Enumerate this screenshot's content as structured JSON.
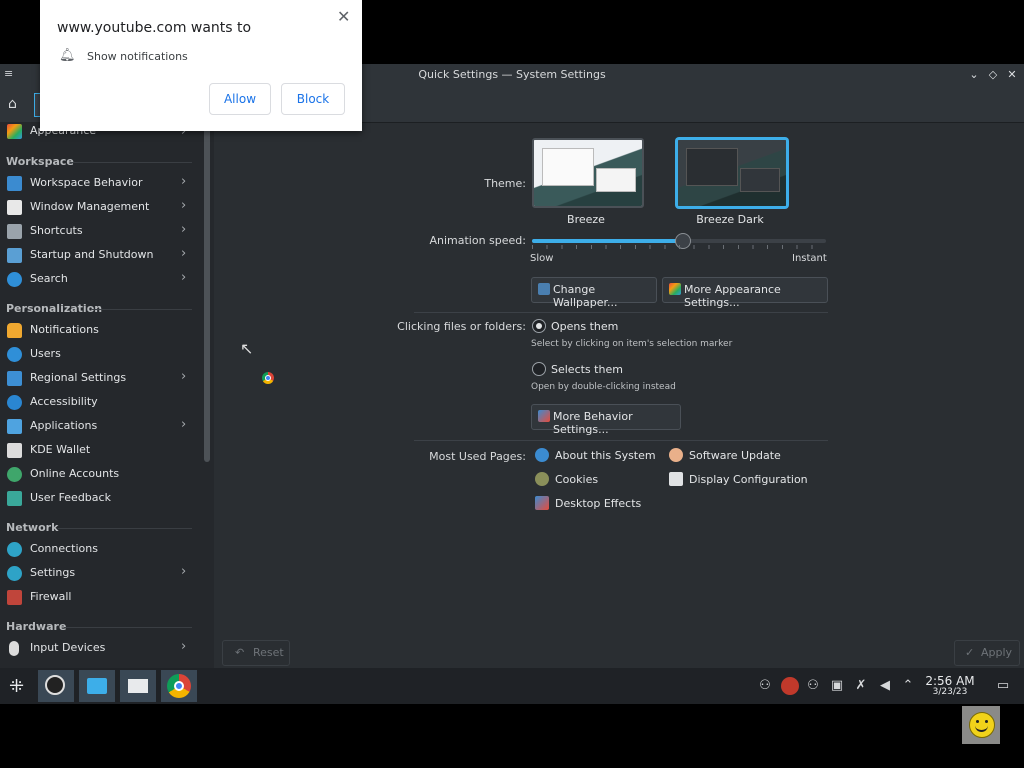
{
  "window": {
    "title": "Quick Settings — System Settings",
    "controls": [
      "minimize",
      "maximize",
      "close"
    ]
  },
  "sidebar": {
    "partial_top_item": "Appearance",
    "sections": [
      {
        "title": "Workspace",
        "items": [
          {
            "label": "Workspace Behavior",
            "has_children": true
          },
          {
            "label": "Window Management",
            "has_children": true
          },
          {
            "label": "Shortcuts",
            "has_children": true
          },
          {
            "label": "Startup and Shutdown",
            "has_children": true
          },
          {
            "label": "Search",
            "has_children": true
          }
        ]
      },
      {
        "title": "Personalization",
        "items": [
          {
            "label": "Notifications",
            "has_children": false
          },
          {
            "label": "Users",
            "has_children": false
          },
          {
            "label": "Regional Settings",
            "has_children": true
          },
          {
            "label": "Accessibility",
            "has_children": false
          },
          {
            "label": "Applications",
            "has_children": true
          },
          {
            "label": "KDE Wallet",
            "has_children": false
          },
          {
            "label": "Online Accounts",
            "has_children": false
          },
          {
            "label": "User Feedback",
            "has_children": false
          }
        ]
      },
      {
        "title": "Network",
        "items": [
          {
            "label": "Connections",
            "has_children": false
          },
          {
            "label": "Settings",
            "has_children": true
          },
          {
            "label": "Firewall",
            "has_children": false
          }
        ]
      },
      {
        "title": "Hardware",
        "items": [
          {
            "label": "Input Devices",
            "has_children": true
          }
        ]
      }
    ]
  },
  "content": {
    "theme_label": "Theme:",
    "themes": [
      {
        "name": "Breeze",
        "selected": false
      },
      {
        "name": "Breeze Dark",
        "selected": true
      }
    ],
    "animation_label": "Animation speed:",
    "animation_speed_fraction": 0.51,
    "slow_label": "Slow",
    "instant_label": "Instant",
    "change_wallpaper_btn": "Change Wallpaper...",
    "more_appearance_btn": "More Appearance Settings...",
    "clicking_label": "Clicking files or folders:",
    "opens_them": "Opens them",
    "opens_them_hint": "Select by clicking on item's selection marker",
    "selects_them": "Selects them",
    "selects_them_hint": "Open by double-clicking instead",
    "more_behavior_btn": "More Behavior Settings...",
    "most_used_label": "Most Used Pages:",
    "most_used": [
      "About this System",
      "Software Update",
      "Cookies",
      "Display Configuration",
      "Desktop Effects"
    ],
    "reset_btn": "Reset",
    "apply_btn": "Apply"
  },
  "popup": {
    "title": "www.youtube.com wants to",
    "permission": "Show notifications",
    "allow": "Allow",
    "block": "Block"
  },
  "taskbar": {
    "time": "2:56 AM",
    "date": "3/23/23",
    "apps": [
      "app-launcher",
      "obs-studio",
      "dolphin-file-manager",
      "system-settings",
      "google-chrome"
    ]
  },
  "colors": {
    "accent": "#3daee9",
    "window_bg": "#2a2e32",
    "sidebar_bg": "#25282c",
    "taskbar_bg": "#1f2226"
  }
}
